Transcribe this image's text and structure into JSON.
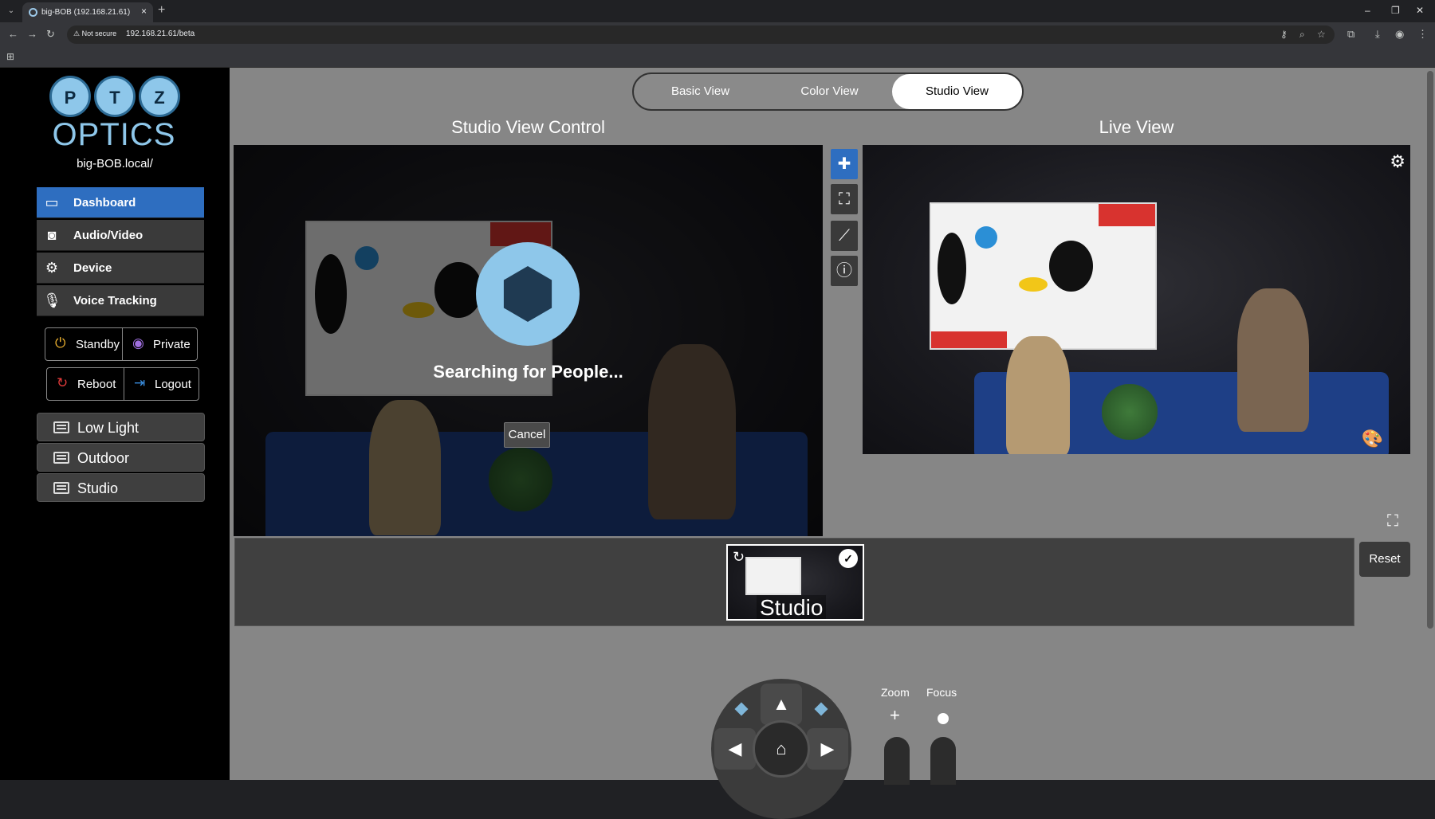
{
  "browser": {
    "tab_title": "big-BOB (192.168.21.61)",
    "security_badge": "⚠ Not secure",
    "url": "192.168.21.61/beta"
  },
  "sidebar": {
    "logo_letters": [
      "P",
      "T",
      "Z"
    ],
    "logo_word": "OPTICS",
    "hostname": "big-BOB.local/",
    "nav": [
      {
        "label": "Dashboard",
        "icon": "camera-icon"
      },
      {
        "label": "Audio/Video",
        "icon": "av-icon"
      },
      {
        "label": "Device",
        "icon": "gear-icon"
      },
      {
        "label": "Voice Tracking",
        "icon": "microphone-icon"
      }
    ],
    "quick": {
      "standby": "Standby",
      "private": "Private",
      "reboot": "Reboot",
      "logout": "Logout"
    },
    "presets": [
      "Low Light",
      "Outdoor",
      "Studio"
    ]
  },
  "views": {
    "tabs": [
      "Basic View",
      "Color View",
      "Studio View"
    ],
    "selected": "Studio View"
  },
  "studio": {
    "title": "Studio View Control",
    "searching": "Searching for People...",
    "cancel": "Cancel"
  },
  "live": {
    "title": "Live View"
  },
  "preset_strip": {
    "thumb_label": "Studio",
    "reset": "Reset"
  },
  "controls": {
    "zoom_label": "Zoom",
    "focus_label": "Focus",
    "zoom_plus": "+"
  },
  "colors": {
    "accent": "#2e6ec0",
    "brand_light_blue": "#8ec7ea",
    "page_bg": "#868686"
  }
}
